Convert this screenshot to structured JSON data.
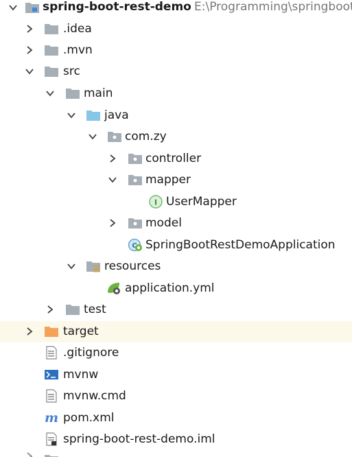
{
  "project": {
    "name": "spring-boot-rest-demo",
    "path": "E:\\Programming\\springboot"
  },
  "items": [
    {
      "label": ".idea"
    },
    {
      "label": ".mvn"
    },
    {
      "label": "src"
    },
    {
      "label": "main"
    },
    {
      "label": "java"
    },
    {
      "label": "com.zy"
    },
    {
      "label": "controller"
    },
    {
      "label": "mapper"
    },
    {
      "label": "UserMapper"
    },
    {
      "label": "model"
    },
    {
      "label": "SpringBootRestDemoApplication"
    },
    {
      "label": "resources"
    },
    {
      "label": "application.yml"
    },
    {
      "label": "test"
    },
    {
      "label": "target"
    },
    {
      "label": ".gitignore"
    },
    {
      "label": "mvnw"
    },
    {
      "label": "mvnw.cmd"
    },
    {
      "label": "pom.xml"
    },
    {
      "label": "spring-boot-rest-demo.iml"
    }
  ],
  "colors": {
    "folder_gray": "#a6aeb6",
    "folder_blue": "#86c6e6",
    "folder_orange": "#f6a15a",
    "selected_row": "#fcf9ea",
    "path_text": "#777777",
    "interface_green": "#6bb96b",
    "spring_green": "#6db33f",
    "terminal_blue": "#2c6fbf",
    "maven_blue": "#4a7fd1"
  }
}
